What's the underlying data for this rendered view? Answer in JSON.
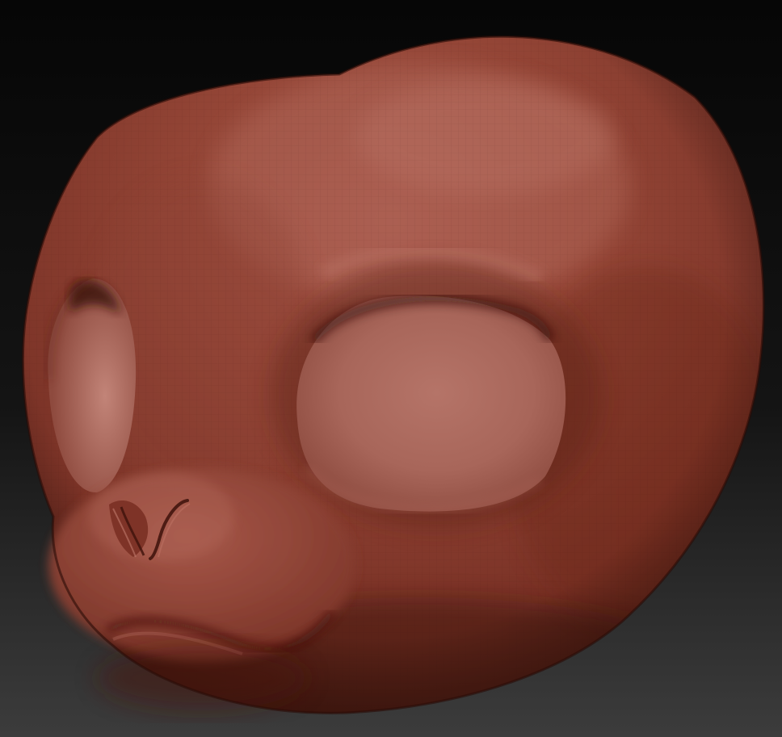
{
  "viewport": {
    "subject": "sculpted-creature-head",
    "colors": {
      "background_top": "#070707",
      "background_bottom": "#3b3b3b",
      "clay_base": "#8a3a2c",
      "clay_highlight": "#c07a6e",
      "clay_shadow": "#4a1a12"
    }
  }
}
